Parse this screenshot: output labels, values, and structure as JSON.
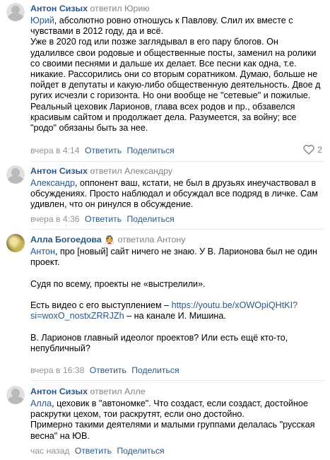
{
  "comments": [
    {
      "author": "Антон Сизых",
      "replied": "ответил Юрию",
      "mention": "Юрий",
      "text": ", абсолютно ровно отношусь к Павлову. Слил их вместе с\nчувствами в 2012 году, да и всё.\nУже в 2020 год или позже заглядывал в его пару блогов. Он\nудалилвсе свои родовые и общественные посты, заменил на ролики\nсо своими песнями и дальше их делает. Все песни как одна, т.е.\nникакие. Рассорились они со вторым соратником. Думаю, больше не\nпойдет в депутаты и какую-либо общественную деятельность. Двое д\nругих исчезли с горизонта. Но они вообще не \"сетевые\" и пожилые.\nРеальный цеховик Ларионов, глава всех родов и пр., обзавелся\nкрасивым сайтом и продолжает дела. Разумеется, за войну; все\n\"родо\" обязаны быть за нее.",
      "time": "вчера в 4:14",
      "reply": "Ответить",
      "share": "Поделиться",
      "likes": "2"
    },
    {
      "author": "Антон Сизых",
      "replied": "ответил Александру",
      "mention": "Александр",
      "text": ", оппонент ваш, кстати, не был в друзьях инеучаствовал в\nобсуждениях. Просто наблюдал и обсуждал все подряд в личке. Сам\nудивлен, что он ринулся в обсуждение.",
      "time": "вчера в 4:36",
      "reply": "Ответить",
      "share": "Поделиться"
    },
    {
      "author": "Алла Богоедова",
      "author_emoji": "👰",
      "replied": "ответила Антону",
      "mention": "Антон",
      "text_before_link": ", про [новый] сайт ничего не знаю. У В. Ларионова был не один\nпроект.\n\nСудя по всему, проекты не «выстрелили».\n\nЕсть видео с его выступлением – ",
      "link": "https://youtu.be/xOWOpiQHtKI?\nsi=woxO_nostxZRRJZh",
      "text_after_link": " – на канале И. Мишина.\n\nВ. Ларионов главный идеолог проектов? Или есть ещё кто-то,\nнепубличный?",
      "time": "вчера в 16:38",
      "reply": "Ответить",
      "share": "Поделиться"
    },
    {
      "author": "Антон Сизых",
      "replied": "ответил Алле",
      "mention": "Алла",
      "text": ", цеховик в \"автономке\". Что создаст, если создаст, достойное\nраскрутки цехом, тои раскрутят, если оно достойно.\nПримерно такими деятелями и малыми группами делалась \"русская\nвесна\" на ЮВ.",
      "time": "час назад",
      "reply": "Ответить",
      "share": "Поделиться"
    }
  ],
  "colors": {
    "link": "#2a5885",
    "meta": "#828282",
    "divider": "#e7e8ec"
  }
}
